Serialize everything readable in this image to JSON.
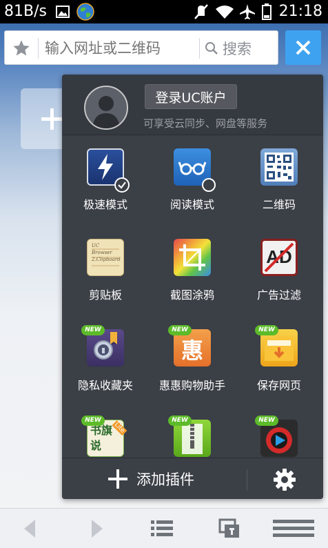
{
  "status_bar": {
    "net_speed": "81B/s",
    "time": "21:18",
    "icons": [
      "image-icon",
      "globe-icon",
      "mute-icon",
      "wifi-icon",
      "airplane-icon",
      "battery-icon"
    ]
  },
  "address_bar": {
    "placeholder": "输入网址或二维码",
    "search_label": "搜索"
  },
  "account": {
    "login_label": "登录UC账户",
    "subtitle": "可享受云同步、网盘等服务"
  },
  "plugins": [
    {
      "label": "极速模式",
      "new": false,
      "icon": "lightning-icon"
    },
    {
      "label": "阅读模式",
      "new": false,
      "icon": "reading-glasses-icon"
    },
    {
      "label": "二维码",
      "new": false,
      "icon": "qrcode-icon"
    },
    {
      "label": "剪贴板",
      "new": false,
      "icon": "clipboard-icon"
    },
    {
      "label": "截图涂鸦",
      "new": false,
      "icon": "crop-icon"
    },
    {
      "label": "广告过滤",
      "new": false,
      "icon": "ad-block-icon"
    },
    {
      "label": "隐私收藏夹",
      "new": true,
      "icon": "privacy-lock-icon"
    },
    {
      "label": "惠惠购物助手",
      "new": true,
      "icon": "hui-shopping-icon"
    },
    {
      "label": "保存网页",
      "new": true,
      "icon": "save-page-icon"
    },
    {
      "label": "",
      "new": true,
      "icon": "novel-lite-icon"
    },
    {
      "label": "",
      "new": true,
      "icon": "zip-icon"
    },
    {
      "label": "",
      "new": true,
      "icon": "video-player-icon"
    }
  ],
  "badge_text": "NEW",
  "clipboard_text": "UC Browser 2.Clipboard",
  "novel_text": "书旗说",
  "novel_badge": "Lite",
  "hui_text": "惠",
  "ad_text": "AD",
  "footer": {
    "add_plugin_label": "添加插件"
  },
  "colors": {
    "accent": "#3ea2f0",
    "menu_bg": "#3b3f46",
    "new_badge": "#5dbb2a"
  }
}
